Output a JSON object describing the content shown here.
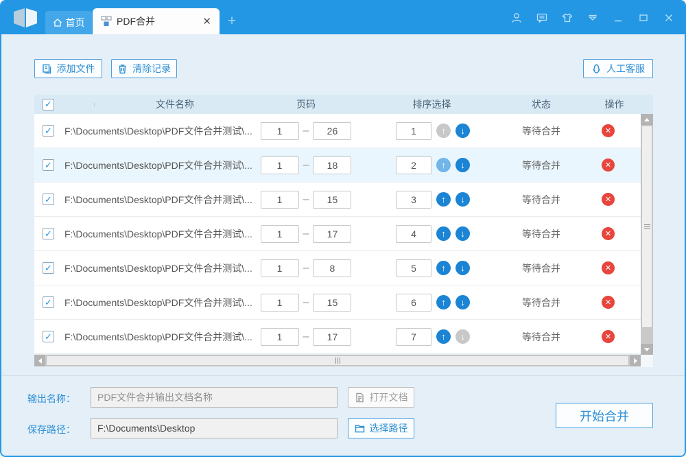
{
  "titlebar": {
    "home_tab": "首页",
    "active_tab": "PDF合并",
    "close_tab": "✕",
    "new_tab": "+",
    "icons": [
      "user-icon",
      "message-icon",
      "skin-icon",
      "menu-arrow-icon",
      "minimize-icon",
      "maximize-icon",
      "close-icon"
    ]
  },
  "toolbar": {
    "add_files": "添加文件",
    "clear_records": "清除记录",
    "support": "人工客服"
  },
  "table": {
    "headers": {
      "name": "文件名称",
      "pages": "页码",
      "sort": "排序选择",
      "status": "状态",
      "action": "操作"
    },
    "check_glyph": "✓",
    "page_separator": "–",
    "delete_glyph": "✕",
    "rows": [
      {
        "checked": true,
        "path": "F:\\Documents\\Desktop\\PDF文件合并测试\\...",
        "page_start": "1",
        "page_end": "26",
        "sort": "1",
        "up": "disabled",
        "down": "normal",
        "status": "等待合并",
        "highlight": false
      },
      {
        "checked": true,
        "path": "F:\\Documents\\Desktop\\PDF文件合并测试\\...",
        "page_start": "1",
        "page_end": "18",
        "sort": "2",
        "up": "light",
        "down": "normal",
        "status": "等待合并",
        "highlight": true
      },
      {
        "checked": true,
        "path": "F:\\Documents\\Desktop\\PDF文件合并测试\\...",
        "page_start": "1",
        "page_end": "15",
        "sort": "3",
        "up": "normal",
        "down": "normal",
        "status": "等待合并",
        "highlight": false
      },
      {
        "checked": true,
        "path": "F:\\Documents\\Desktop\\PDF文件合并测试\\...",
        "page_start": "1",
        "page_end": "17",
        "sort": "4",
        "up": "normal",
        "down": "normal",
        "status": "等待合并",
        "highlight": false
      },
      {
        "checked": true,
        "path": "F:\\Documents\\Desktop\\PDF文件合并测试\\...",
        "page_start": "1",
        "page_end": "8",
        "sort": "5",
        "up": "normal",
        "down": "normal",
        "status": "等待合并",
        "highlight": false
      },
      {
        "checked": true,
        "path": "F:\\Documents\\Desktop\\PDF文件合并测试\\...",
        "page_start": "1",
        "page_end": "15",
        "sort": "6",
        "up": "normal",
        "down": "normal",
        "status": "等待合并",
        "highlight": false
      },
      {
        "checked": true,
        "path": "F:\\Documents\\Desktop\\PDF文件合并测试\\...",
        "page_start": "1",
        "page_end": "17",
        "sort": "7",
        "up": "normal",
        "down": "disabled",
        "status": "等待合并",
        "highlight": false
      }
    ]
  },
  "footer": {
    "output_label": "输出名称：",
    "output_placeholder": "PDF文件合并输出文档名称",
    "open_doc": "打开文档",
    "save_label": "保存路径：",
    "save_value": "F:\\Documents\\Desktop",
    "choose_path": "选择路径",
    "start_merge": "开始合并"
  },
  "colors": {
    "accent_blue": "#2497e4",
    "button_blue": "#2d8fd4",
    "header_bg": "#d9eaf5",
    "delete_red": "#e8453c",
    "arrow_blue": "#1b84d4",
    "disabled_gray": "#c8c8c8"
  }
}
